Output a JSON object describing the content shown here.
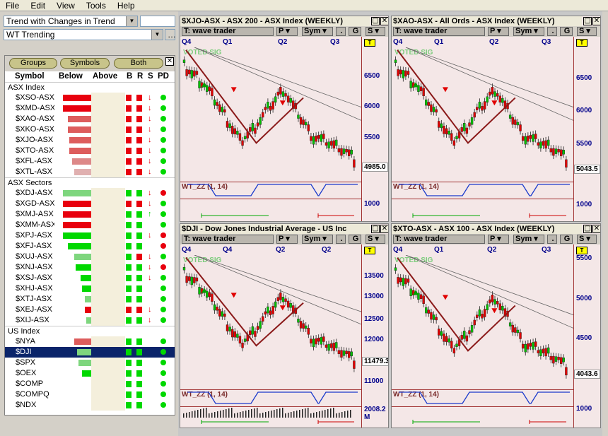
{
  "menu": [
    "File",
    "Edit",
    "View",
    "Tools",
    "Help"
  ],
  "left": {
    "scan_combo": "Trend with Changes in Trend",
    "layout_combo": "WT Trending",
    "buttons": [
      "Groups",
      "Symbols",
      "Both"
    ],
    "headers": [
      "Symbol",
      "Below",
      "Above",
      "B",
      "R",
      "S",
      "PD"
    ],
    "groups": [
      {
        "name": "ASX Index",
        "rows": [
          {
            "sym": "$XSO-ASX",
            "below": 0.92,
            "bcolor": "#e8000e",
            "b": "#e8000e",
            "r": "#e8000e",
            "s": "down",
            "pd": "#00d800"
          },
          {
            "sym": "$XMD-ASX",
            "below": 0.92,
            "bcolor": "#e8000e",
            "b": "#e8000e",
            "r": "#e8000e",
            "s": "down",
            "pd": "#00d800"
          },
          {
            "sym": "$XAO-ASX",
            "below": 0.75,
            "bcolor": "#dd5c5c",
            "b": "#e8000e",
            "r": "#e8000e",
            "s": "down",
            "pd": "#00d800"
          },
          {
            "sym": "$XKO-ASX",
            "below": 0.75,
            "bcolor": "#dd5c5c",
            "b": "#e8000e",
            "r": "#e8000e",
            "s": "down",
            "pd": "#00d800"
          },
          {
            "sym": "$XJO-ASX",
            "below": 0.7,
            "bcolor": "#dd5c5c",
            "b": "#e8000e",
            "r": "#e8000e",
            "s": "down",
            "pd": "#00d800"
          },
          {
            "sym": "$XTO-ASX",
            "below": 0.7,
            "bcolor": "#dd5c5c",
            "b": "#e8000e",
            "r": "#e8000e",
            "s": "down",
            "pd": "#00d800"
          },
          {
            "sym": "$XFL-ASX",
            "below": 0.62,
            "bcolor": "#dd8888",
            "b": "#e8000e",
            "r": "#e8000e",
            "s": "down",
            "pd": "#00d800"
          },
          {
            "sym": "$XTL-ASX",
            "below": 0.55,
            "bcolor": "#e0b0b0",
            "b": "#e8000e",
            "r": "#e8000e",
            "s": "down",
            "pd": "#00d800"
          }
        ]
      },
      {
        "name": "ASX Sectors",
        "rows": [
          {
            "sym": "$XDJ-ASX",
            "below": 0.92,
            "bcolor": "#7ed67e",
            "b": "#00d800",
            "r": "#00d800",
            "s": "down",
            "pd": "#e8000e"
          },
          {
            "sym": "$XGD-ASX",
            "below": 0.92,
            "bcolor": "#e8000e",
            "b": "#e8000e",
            "r": "#e8000e",
            "s": "down",
            "pd": "#00d800"
          },
          {
            "sym": "$XMJ-ASX",
            "below": 0.92,
            "bcolor": "#e8000e",
            "b": "#00d800",
            "r": "#00d800",
            "s": "up",
            "pd": "#00d800"
          },
          {
            "sym": "$XMM-ASX",
            "below": 0.92,
            "bcolor": "#e8000e",
            "b": "#00d800",
            "r": "#00d800",
            "s": "",
            "pd": "#00d800"
          },
          {
            "sym": "$XPJ-ASX",
            "below": 0.92,
            "bcolor": "#00d800",
            "b": "#00d800",
            "r": "#00d800",
            "s": "down",
            "pd": "#e8000e"
          },
          {
            "sym": "$XFJ-ASX",
            "below": 0.75,
            "bcolor": "#00d800",
            "b": "#00d800",
            "r": "#00d800",
            "s": "",
            "pd": "#e8000e"
          },
          {
            "sym": "$XUJ-ASX",
            "below": 0.55,
            "bcolor": "#7ed67e",
            "b": "#00d800",
            "r": "#e8000e",
            "s": "down",
            "pd": "#00d800"
          },
          {
            "sym": "$XNJ-ASX",
            "below": 0.5,
            "bcolor": "#00d800",
            "b": "#00d800",
            "r": "#00d800",
            "s": "down",
            "pd": "#e8000e"
          },
          {
            "sym": "$XSJ-ASX",
            "below": 0.35,
            "bcolor": "#00d800",
            "b": "#00d800",
            "r": "#00d800",
            "s": "down",
            "pd": "#00d800"
          },
          {
            "sym": "$XHJ-ASX",
            "below": 0.3,
            "bcolor": "#00d800",
            "b": "#00d800",
            "r": "#00d800",
            "s": "",
            "pd": "#00d800"
          },
          {
            "sym": "$XTJ-ASX",
            "below": 0.2,
            "bcolor": "#7ed67e",
            "b": "#00d800",
            "r": "#00d800",
            "s": "",
            "pd": "#00d800"
          },
          {
            "sym": "$XEJ-ASX",
            "below": 0.2,
            "bcolor": "#e8000e",
            "b": "#e8000e",
            "r": "#e8000e",
            "s": "down",
            "pd": "#00d800"
          },
          {
            "sym": "$XIJ-ASX",
            "below": 0.15,
            "bcolor": "#7ed67e",
            "b": "#00d800",
            "r": "#00d800",
            "s": "down",
            "pd": "#00d800"
          }
        ]
      },
      {
        "name": "US Index",
        "rows": [
          {
            "sym": "$NYA",
            "below": 0.55,
            "bcolor": "#dd5c5c",
            "b": "#00d800",
            "r": "#00d800",
            "s": "",
            "pd": "#00d800"
          },
          {
            "sym": "$DJI",
            "below": 0.45,
            "bcolor": "#7ed67e",
            "b": "#00d800",
            "r": "#00d800",
            "s": "",
            "pd": "#00d800",
            "selected": true
          },
          {
            "sym": "$SPX",
            "below": 0.4,
            "bcolor": "#7ed67e",
            "b": "#00d800",
            "r": "#00d800",
            "s": "",
            "pd": "#00d800"
          },
          {
            "sym": "$OEX",
            "below": 0.3,
            "bcolor": "#00d800",
            "b": "#00d800",
            "r": "#00d800",
            "s": "",
            "pd": "#00d800"
          },
          {
            "sym": "$COMP",
            "below": 0.0,
            "bcolor": "#00d800",
            "b": "#00d800",
            "r": "#00d800",
            "s": "",
            "pd": "#00d800"
          },
          {
            "sym": "$COMPQ",
            "below": 0.0,
            "bcolor": "#00d800",
            "b": "#00d800",
            "r": "#00d800",
            "s": "",
            "pd": "#00d800"
          },
          {
            "sym": "$NDX",
            "below": 0.0,
            "bcolor": "#00d800",
            "b": "#00d800",
            "r": "#00d800",
            "s": "",
            "pd": "#00d800"
          }
        ]
      }
    ]
  },
  "charts": [
    {
      "title": "$XJO-ASX - ASX 200 - ASX Index (WEEKLY)",
      "template": "T: wave trader",
      "p": "P",
      "sym": "Sym",
      "g": "G",
      "s": "S",
      "quarters": [
        "Q4",
        "Q1",
        "Q2",
        "Q3"
      ],
      "prices": [
        "6500",
        "6000",
        "5500",
        "1000"
      ],
      "last": "4985.0",
      "ind": "WT_ZZ (1, 14)",
      "voted": "VOTED SIG"
    },
    {
      "title": "$XAO-ASX - All Ords - ASX Index (WEEKLY)",
      "template": "T: wave trader",
      "p": "P",
      "sym": "Sym",
      "g": "G",
      "s": "S",
      "quarters": [
        "Q4",
        "Q1",
        "Q2",
        "Q3"
      ],
      "prices": [
        "6500",
        "6000",
        "5500",
        "1000"
      ],
      "last": "5043.5",
      "ind": "WT_ZZ (1, 14)",
      "voted": "VOTED SIG"
    },
    {
      "title": "$DJI - Dow Jones Industrial Average - US Inc",
      "template": "T: wave trader",
      "p": "P",
      "sym": "Sym",
      "g": "G",
      "s": "S",
      "quarters": [
        "Q4",
        "Q4",
        "Q2",
        "Q2"
      ],
      "prices": [
        "13500",
        "13000",
        "12500",
        "12000",
        "11000"
      ],
      "last": "11479.39",
      "vol": "2008.2 M",
      "ind": "WT_ZZ (1, 14)",
      "voted": "VOTED SIG"
    },
    {
      "title": "$XTO-ASX - ASX 100 - ASX Index (WEEKLY)",
      "template": "T: wave trader",
      "p": "P",
      "sym": "Sym",
      "g": "G",
      "s": "S",
      "quarters": [
        "Q4",
        "Q1",
        "Q2",
        "Q3"
      ],
      "prices": [
        "5500",
        "5000",
        "4500",
        "1000"
      ],
      "last": "4043.6",
      "ind": "WT_ZZ (1, 14)",
      "voted": "VOTED SIG"
    }
  ],
  "watermark": {
    "line1": "US I",
    "line2": "ASX Index",
    "line3": "ASX Se"
  }
}
